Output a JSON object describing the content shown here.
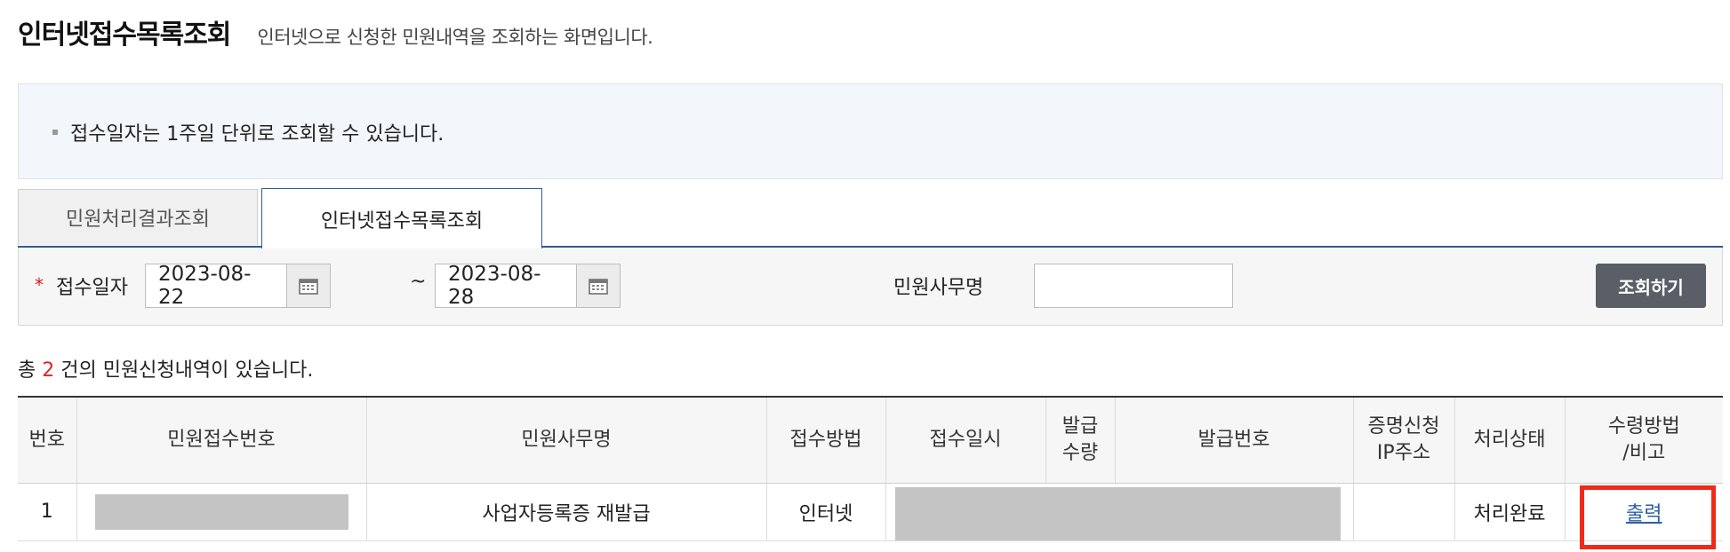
{
  "page": {
    "title": "인터넷접수목록조회",
    "description": "인터넷으로 신청한 민원내역을 조회하는 화면입니다."
  },
  "notice": {
    "items": [
      "접수일자는 1주일 단위로 조회할 수 있습니다."
    ]
  },
  "tabs": [
    {
      "label": "민원처리결과조회",
      "active": false
    },
    {
      "label": "인터넷접수목록조회",
      "active": true
    }
  ],
  "search": {
    "required_mark": "*",
    "date_label": "접수일자",
    "date_from": "2023-08-22",
    "date_separator": "~",
    "date_to": "2023-08-28",
    "name_label": "민원사무명",
    "name_value": "",
    "button_label": "조회하기"
  },
  "summary": {
    "prefix": "총 ",
    "count": "2",
    "suffix": " 건의 민원신청내역이 있습니다."
  },
  "table": {
    "headers": {
      "no": "번호",
      "receipt_no": "민원접수번호",
      "service_name": "민원사무명",
      "method": "접수방법",
      "datetime": "접수일시",
      "qty_1": "발급",
      "qty_2": "수량",
      "issue_no": "발급번호",
      "ip_1": "증명신청",
      "ip_2": "IP주소",
      "status": "처리상태",
      "remark_1": "수령방법",
      "remark_2": "/비고"
    },
    "rows": [
      {
        "no": "1",
        "service_name": "사업자등록증 재발급",
        "method": "인터넷",
        "status": "처리완료",
        "action": "출력"
      }
    ]
  },
  "colors": {
    "accent": "#2f5b94",
    "count": "#e02424",
    "highlight": "#f02a1a",
    "button": "#5a5e66",
    "link": "#2d5fa8"
  }
}
